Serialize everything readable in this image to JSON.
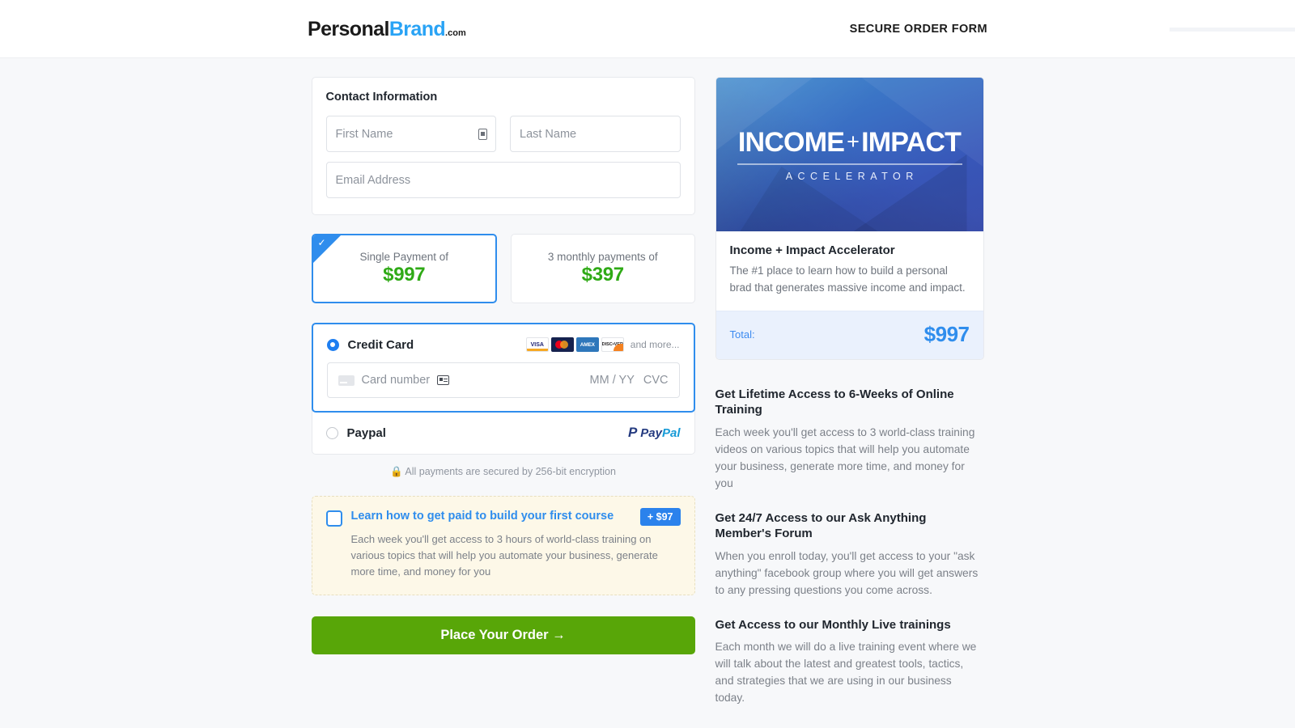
{
  "header": {
    "logo_main": "Personal",
    "logo_accent": "Brand",
    "logo_tld": ".com",
    "secure_label": "SECURE ORDER FORM"
  },
  "contact": {
    "title": "Contact Information",
    "first_name_placeholder": "First Name",
    "last_name_placeholder": "Last Name",
    "email_placeholder": "Email Address"
  },
  "plans": [
    {
      "label": "Single Payment of",
      "price": "$997",
      "selected": true
    },
    {
      "label": "3 monthly payments of",
      "price": "$397",
      "selected": false
    }
  ],
  "payment": {
    "credit_card_label": "Credit Card",
    "brands": [
      "VISA",
      "MC",
      "AMEX",
      "DISC•VER"
    ],
    "and_more": "and more...",
    "card_placeholder": "Card number",
    "expiry_placeholder": "MM / YY",
    "cvc_placeholder": "CVC",
    "paypal_label": "Paypal",
    "paypal_logo_a": "Pay",
    "paypal_logo_b": "Pal",
    "secure_note": "All payments are secured by 256-bit encryption"
  },
  "bump": {
    "title": "Learn how to get paid to build your first course",
    "badge": "+ $97",
    "body": "Each week you'll get access to 3 hours of world-class training on various topics that will help you automate your business, generate more time, and money for you"
  },
  "order_button": {
    "label": "Place Your Order →"
  },
  "product": {
    "banner_title_a": "INCOME",
    "banner_plus": "+",
    "banner_title_b": "IMPACT",
    "banner_subtitle": "ACCELERATOR",
    "name": "Income + Impact Accelerator",
    "description": "The #1 place to learn how to build a personal brad that generates massive income and impact.",
    "total_label": "Total:",
    "total_value": "$997"
  },
  "benefits": [
    {
      "title": "Get Lifetime Access to 6-Weeks of Online Training",
      "text": "Each week you'll get access to 3 world-class training videos on various topics that will help you automate your business, generate more time, and money for you"
    },
    {
      "title": "Get 24/7 Access to our Ask Anything Member's Forum",
      "text": "When you enroll today, you'll get access to your \"ask anything\" facebook group where you will get answers to any pressing questions you come across."
    },
    {
      "title": "Get Access to our Monthly Live trainings",
      "text": "Each month we will do a live training event where we will talk about the latest and greatest tools, tactics, and strategies that we are using in our business today."
    }
  ],
  "colors": {
    "accent_blue": "#2f8ded",
    "price_green": "#2faa16",
    "button_green": "#58a608",
    "bump_bg": "#fdf8e8"
  }
}
